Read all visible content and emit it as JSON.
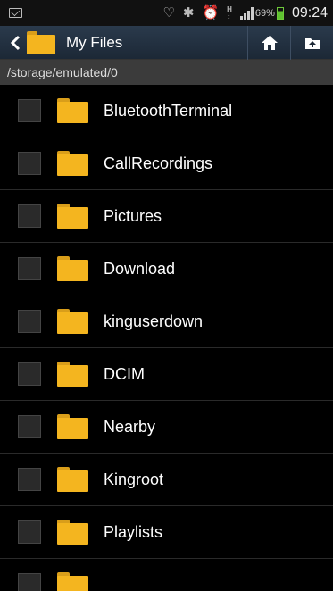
{
  "status_bar": {
    "battery": "69%",
    "time": "09:24",
    "network": "H"
  },
  "action_bar": {
    "title": "My Files"
  },
  "path": "/storage/emulated/0",
  "files": [
    {
      "name": "BluetoothTerminal"
    },
    {
      "name": "CallRecordings"
    },
    {
      "name": "Pictures"
    },
    {
      "name": "Download"
    },
    {
      "name": "kinguserdown"
    },
    {
      "name": "DCIM"
    },
    {
      "name": "Nearby"
    },
    {
      "name": "Kingroot"
    },
    {
      "name": "Playlists"
    },
    {
      "name": ""
    }
  ],
  "colors": {
    "folder": "#f4b51f",
    "action_bar": "#1c2836",
    "battery": "#5fc230"
  }
}
